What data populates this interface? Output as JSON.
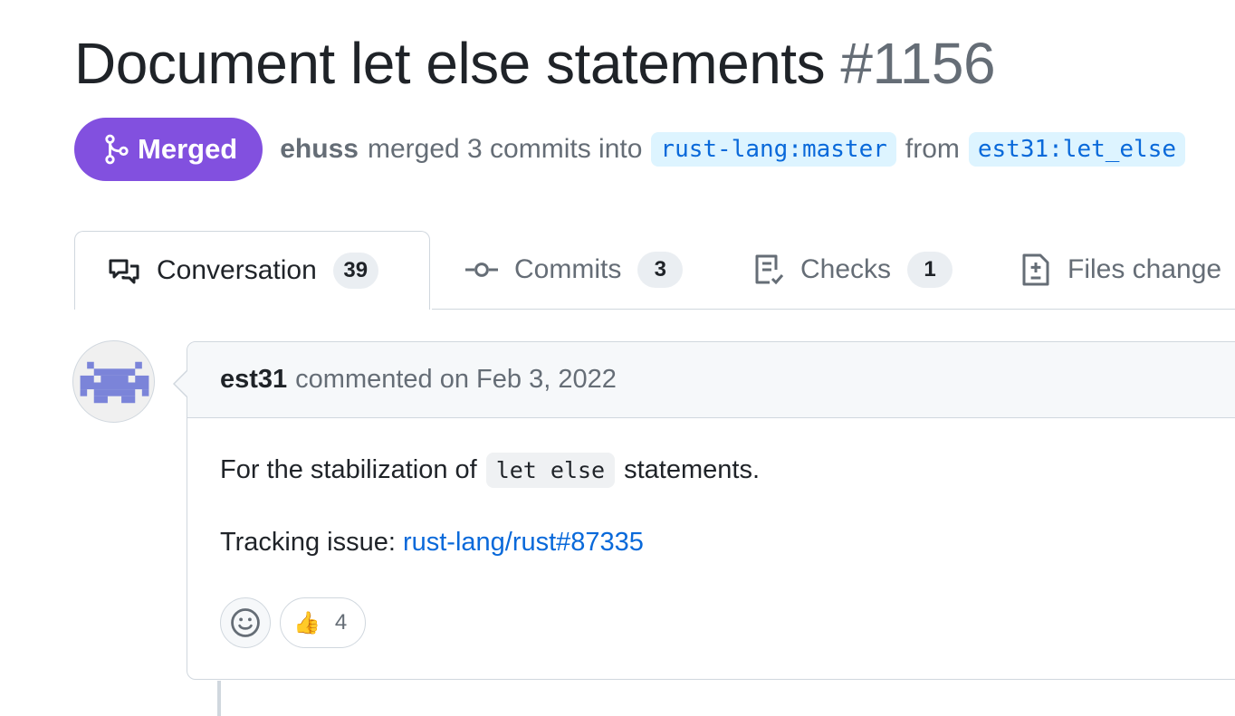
{
  "title": "Document let else statements",
  "number": "#1156",
  "state_badge": "Merged",
  "meta": {
    "author": "ehuss",
    "text_merged": "merged 3 commits into",
    "base_branch": "rust-lang:master",
    "from": "from",
    "head_branch": "est31:let_else"
  },
  "tabs": [
    {
      "label": "Conversation",
      "count": "39",
      "icon": "comment-discussion-icon"
    },
    {
      "label": "Commits",
      "count": "3",
      "icon": "git-commit-icon"
    },
    {
      "label": "Checks",
      "count": "1",
      "icon": "checklist-icon"
    },
    {
      "label": "Files change",
      "icon": "file-diff-icon"
    }
  ],
  "comment": {
    "author": "est31",
    "action": "commented on Feb 3, 2022",
    "line1_prefix": "For the stabilization of",
    "line1_code": "let else",
    "line1_suffix": "statements.",
    "line2_prefix": "Tracking issue:",
    "line2_link": "rust-lang/rust#87335",
    "reactions": [
      {
        "emoji": "👍",
        "count": "4"
      }
    ]
  },
  "colors": {
    "merged": "#8250df",
    "link": "#0969da",
    "branch_bg": "#ddf4ff"
  }
}
